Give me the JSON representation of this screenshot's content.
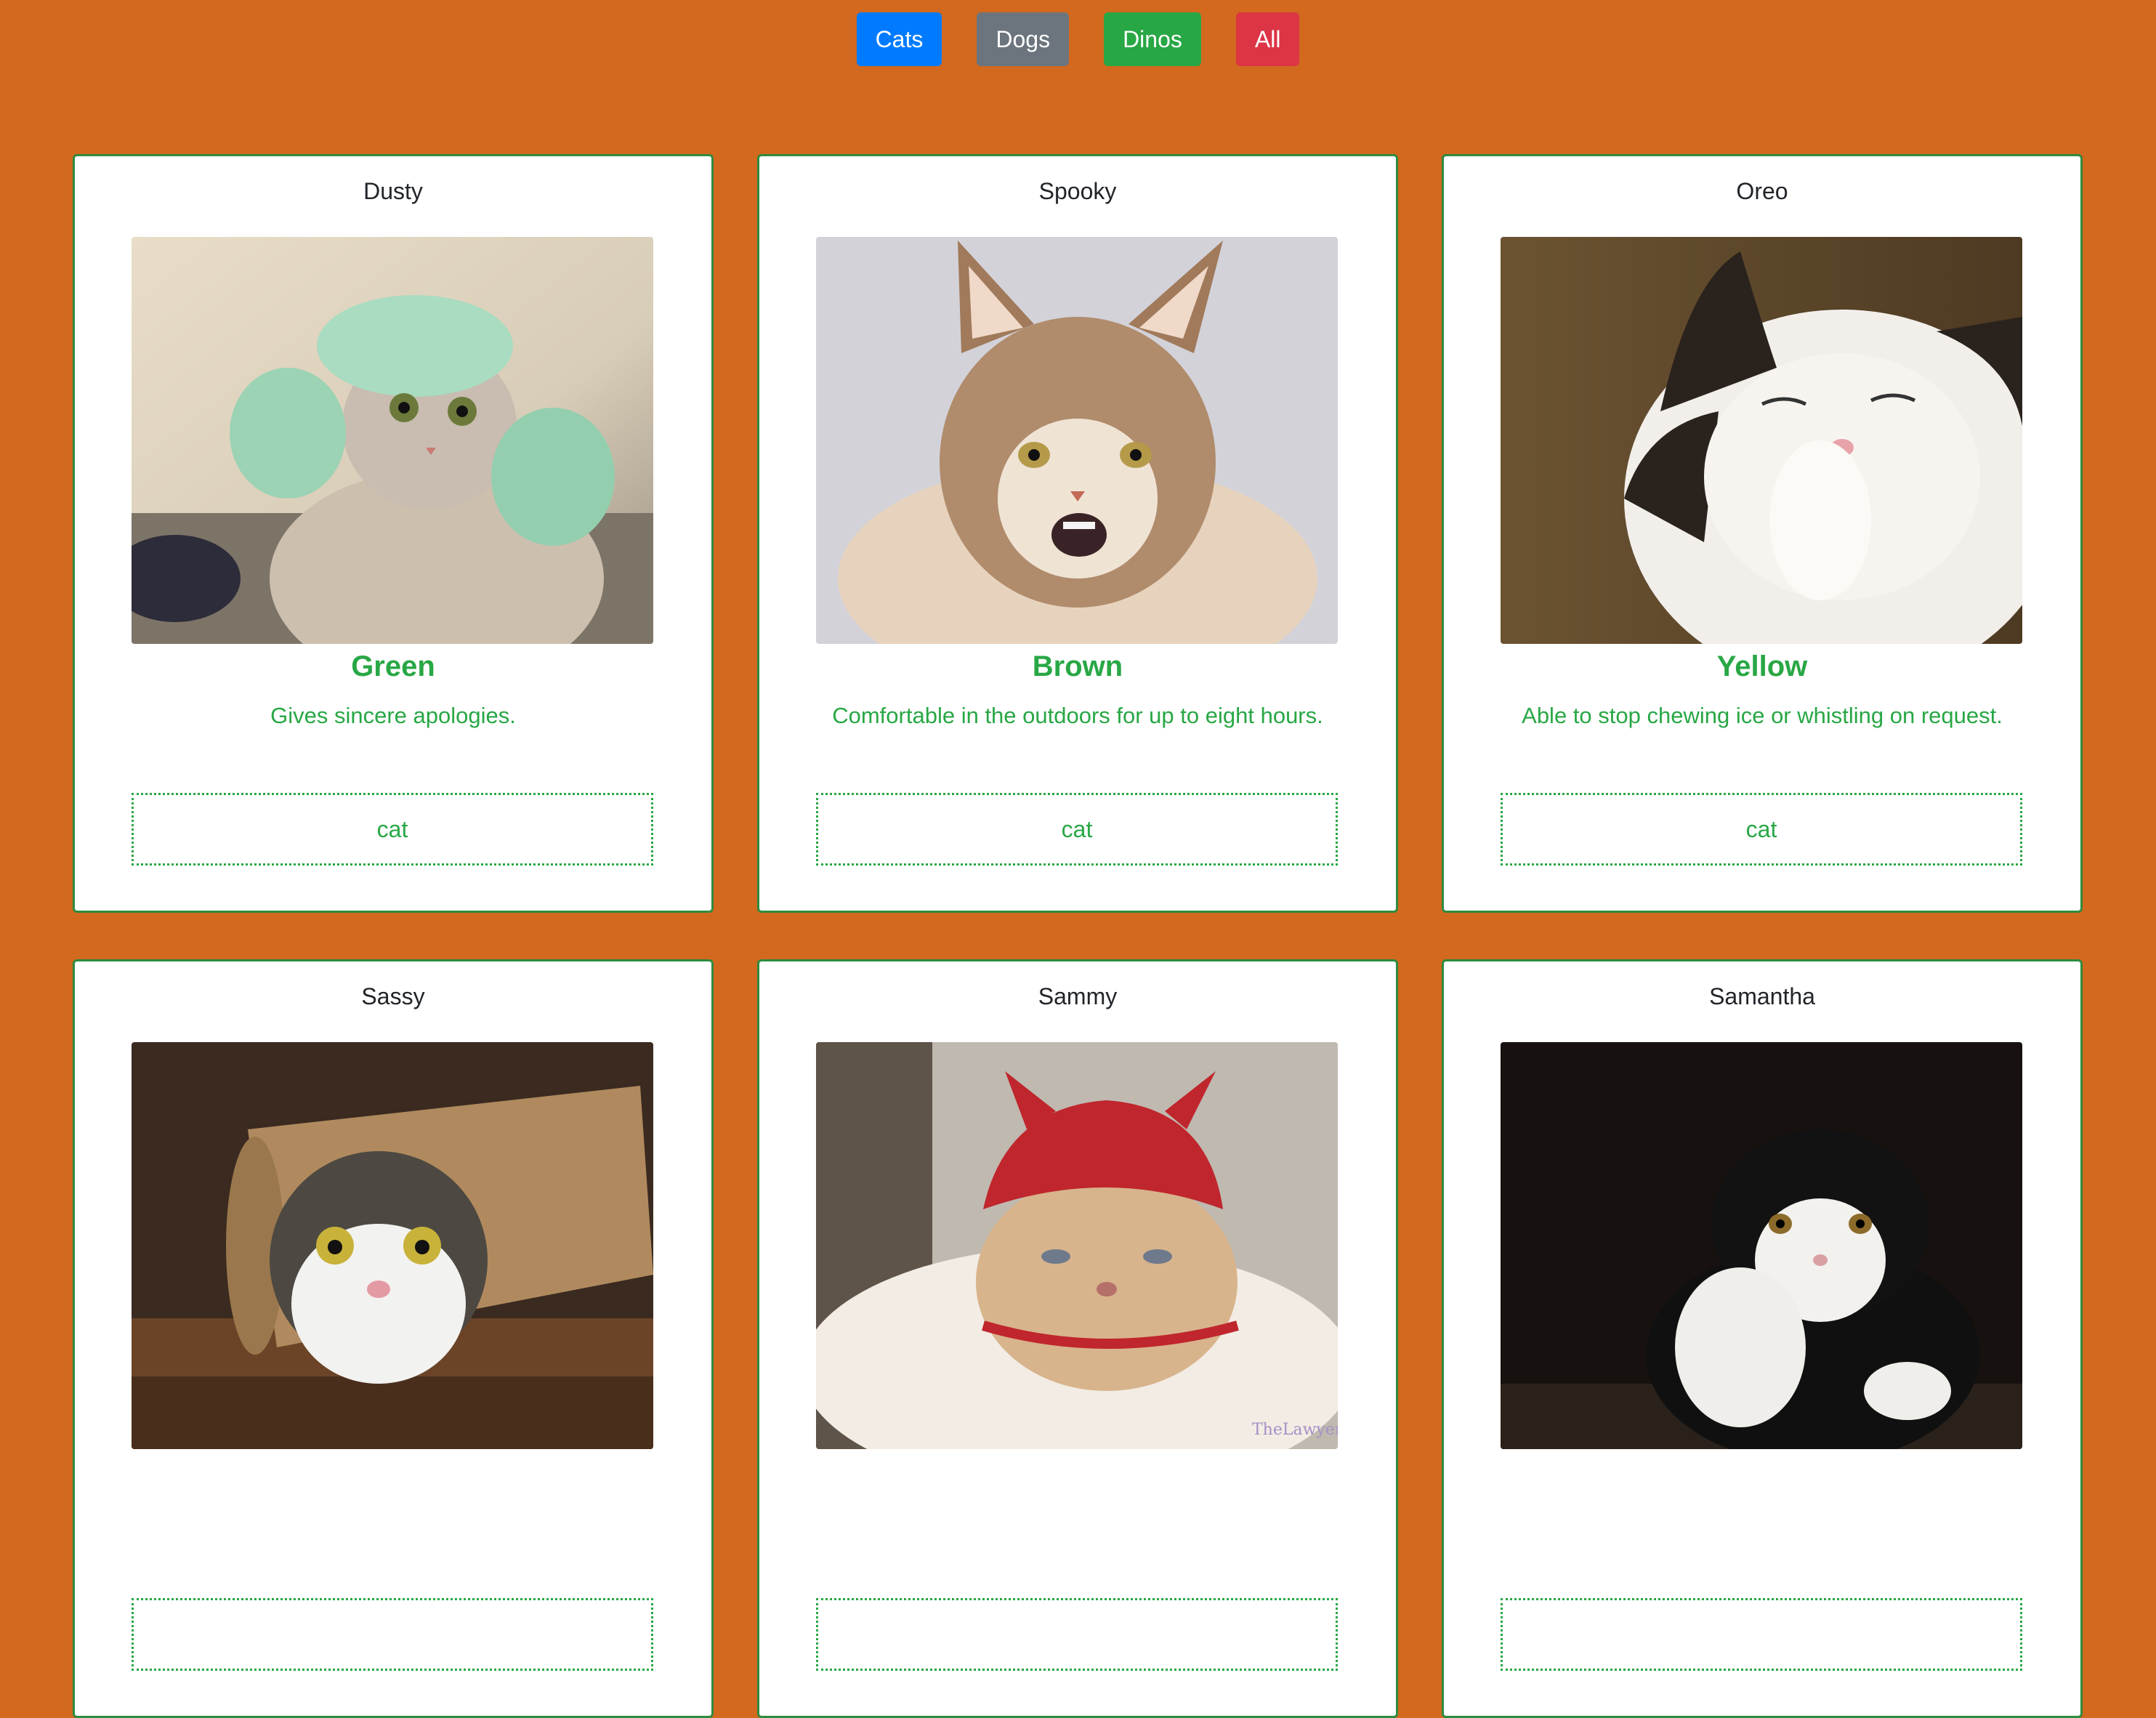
{
  "filters": [
    {
      "label": "Cats",
      "color": "#007bff"
    },
    {
      "label": "Dogs",
      "color": "#6c757d"
    },
    {
      "label": "Dinos",
      "color": "#28a745"
    },
    {
      "label": "All",
      "color": "#dc3545"
    }
  ],
  "theme": {
    "page_background": "#d2691e",
    "card_border": "#2e8b3f",
    "accent_green": "#28a745"
  },
  "cards": [
    {
      "name": "Dusty",
      "color": "Green",
      "description": "Gives sincere apologies.",
      "tag": "cat",
      "photo": "cat-in-knit-earmuffs"
    },
    {
      "name": "Spooky",
      "color": "Brown",
      "description": "Comfortable in the outdoors for up to eight hours.",
      "tag": "cat",
      "photo": "maine-coon-cat-hissing"
    },
    {
      "name": "Oreo",
      "color": "Yellow",
      "description": "Able to stop chewing ice or whistling on request.",
      "tag": "cat",
      "photo": "white-cat-covering-face"
    },
    {
      "name": "Sassy",
      "color": "",
      "description": "",
      "tag": "",
      "photo": "cat-in-paper-roll"
    },
    {
      "name": "Sammy",
      "color": "",
      "description": "",
      "tag": "",
      "photo": "persian-cat-in-red-devil-hat"
    },
    {
      "name": "Samantha",
      "color": "",
      "description": "",
      "tag": "",
      "photo": "black-and-white-scottish-fold-cat"
    }
  ]
}
